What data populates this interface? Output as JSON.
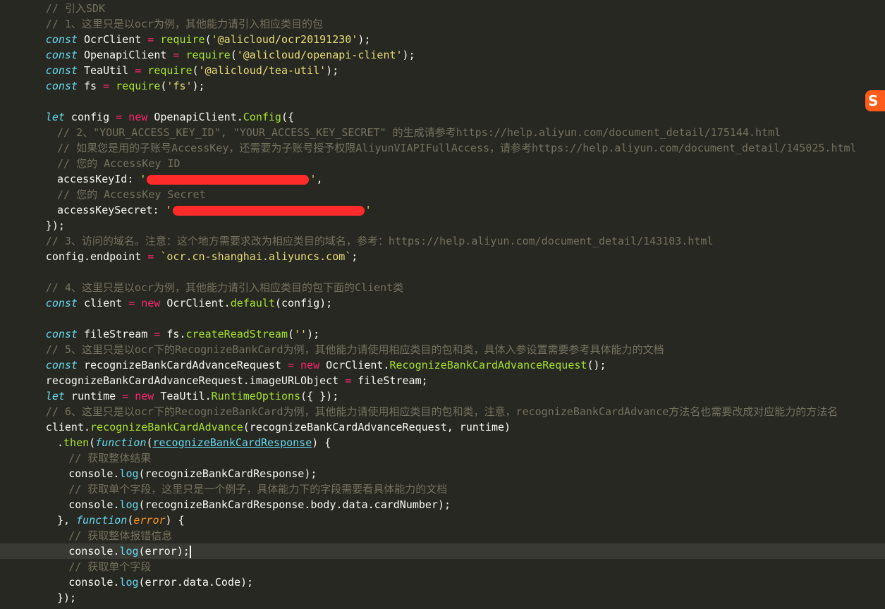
{
  "ime_logo_text": "S",
  "lines": [
    {
      "indent": 4,
      "tokens": [
        [
          "cm",
          "// 引入SDK"
        ]
      ]
    },
    {
      "indent": 4,
      "tokens": [
        [
          "cm",
          "// 1、这里只是以ocr为例，其他能力请引入相应类目的包"
        ]
      ]
    },
    {
      "indent": 4,
      "tokens": [
        [
          "kw",
          "const"
        ],
        [
          "var",
          " OcrClient "
        ],
        [
          "op",
          "="
        ],
        [
          "var",
          " "
        ],
        [
          "fn",
          "require"
        ],
        [
          "var",
          "("
        ],
        [
          "str",
          "'@alicloud/ocr20191230'"
        ],
        [
          "var",
          ");"
        ]
      ]
    },
    {
      "indent": 4,
      "tokens": [
        [
          "kw",
          "const"
        ],
        [
          "var",
          " OpenapiClient "
        ],
        [
          "op",
          "="
        ],
        [
          "var",
          " "
        ],
        [
          "fn",
          "require"
        ],
        [
          "var",
          "("
        ],
        [
          "str",
          "'@alicloud/openapi-client'"
        ],
        [
          "var",
          ");"
        ]
      ]
    },
    {
      "indent": 4,
      "tokens": [
        [
          "kw",
          "const"
        ],
        [
          "var",
          " TeaUtil "
        ],
        [
          "op",
          "="
        ],
        [
          "var",
          " "
        ],
        [
          "fn",
          "require"
        ],
        [
          "var",
          "("
        ],
        [
          "str",
          "'@alicloud/tea-util'"
        ],
        [
          "var",
          ");"
        ]
      ]
    },
    {
      "indent": 4,
      "tokens": [
        [
          "kw",
          "const"
        ],
        [
          "var",
          " fs "
        ],
        [
          "op",
          "="
        ],
        [
          "var",
          " "
        ],
        [
          "fn",
          "require"
        ],
        [
          "var",
          "("
        ],
        [
          "str",
          "'fs'"
        ],
        [
          "var",
          ");"
        ]
      ]
    },
    {
      "indent": 0,
      "tokens": []
    },
    {
      "indent": 4,
      "tokens": [
        [
          "kw",
          "let"
        ],
        [
          "var",
          " config "
        ],
        [
          "op",
          "="
        ],
        [
          "var",
          " "
        ],
        [
          "op",
          "new"
        ],
        [
          "var",
          " OpenapiClient."
        ],
        [
          "fn",
          "Config"
        ],
        [
          "var",
          "({"
        ]
      ]
    },
    {
      "indent": 5,
      "tokens": [
        [
          "cm",
          "// 2、\"YOUR_ACCESS_KEY_ID\", \"YOUR_ACCESS_KEY_SECRET\" 的生成请参考https://help.aliyun.com/document_detail/175144.html"
        ]
      ]
    },
    {
      "indent": 5,
      "tokens": [
        [
          "cm",
          "// 如果您是用的子账号AccessKey，还需要为子账号授予权限AliyunVIAPIFullAccess，请参考https://help.aliyun.com/document_detail/145025.html"
        ]
      ]
    },
    {
      "indent": 5,
      "tokens": [
        [
          "cm",
          "// 您的 AccessKey ID"
        ]
      ]
    },
    {
      "indent": 5,
      "tokens": [
        [
          "var",
          "accessKeyId: "
        ],
        [
          "str",
          "'"
        ],
        [
          "redact",
          "230"
        ],
        [
          "str",
          "'"
        ],
        [
          "var",
          ","
        ]
      ]
    },
    {
      "indent": 5,
      "tokens": [
        [
          "cm",
          "// 您的 AccessKey Secret"
        ]
      ]
    },
    {
      "indent": 5,
      "tokens": [
        [
          "var",
          "accessKeySecret: "
        ],
        [
          "str",
          "'"
        ],
        [
          "redact",
          "272"
        ],
        [
          "str",
          "'"
        ]
      ]
    },
    {
      "indent": 4,
      "tokens": [
        [
          "var",
          "});"
        ]
      ]
    },
    {
      "indent": 4,
      "tokens": [
        [
          "cm",
          "// 3、访问的域名。注意：这个地方需要求改为相应类目的域名，参考：https://help.aliyun.com/document_detail/143103.html"
        ]
      ]
    },
    {
      "indent": 4,
      "tokens": [
        [
          "var",
          "config.endpoint "
        ],
        [
          "op",
          "="
        ],
        [
          "var",
          " "
        ],
        [
          "str",
          "`ocr.cn-shanghai.aliyuncs.com`"
        ],
        [
          "var",
          ";"
        ]
      ]
    },
    {
      "indent": 0,
      "tokens": []
    },
    {
      "indent": 4,
      "tokens": [
        [
          "cm",
          "// 4、这里只是以ocr为例，其他能力请引入相应类目的包下面的Client类"
        ]
      ]
    },
    {
      "indent": 4,
      "tokens": [
        [
          "kw",
          "const"
        ],
        [
          "var",
          " client "
        ],
        [
          "op",
          "="
        ],
        [
          "var",
          " "
        ],
        [
          "op",
          "new"
        ],
        [
          "var",
          " OcrClient."
        ],
        [
          "fn",
          "default"
        ],
        [
          "var",
          "(config);"
        ]
      ]
    },
    {
      "indent": 0,
      "tokens": []
    },
    {
      "indent": 4,
      "tokens": [
        [
          "kw",
          "const"
        ],
        [
          "var",
          " fileStream "
        ],
        [
          "op",
          "="
        ],
        [
          "var",
          " fs."
        ],
        [
          "fn",
          "createReadStream"
        ],
        [
          "var",
          "("
        ],
        [
          "str",
          "''"
        ],
        [
          "var",
          ");"
        ]
      ]
    },
    {
      "indent": 4,
      "tokens": [
        [
          "cm",
          "// 5、这里只是以ocr下的RecognizeBankCard为例，其他能力请使用相应类目的包和类，具体入参设置需要参考具体能力的文档"
        ]
      ]
    },
    {
      "indent": 4,
      "tokens": [
        [
          "kw",
          "const"
        ],
        [
          "var",
          " recognizeBankCardAdvanceRequest "
        ],
        [
          "op",
          "="
        ],
        [
          "var",
          " "
        ],
        [
          "op",
          "new"
        ],
        [
          "var",
          " OcrClient."
        ],
        [
          "fn",
          "RecognizeBankCardAdvanceRequest"
        ],
        [
          "var",
          "();"
        ]
      ]
    },
    {
      "indent": 4,
      "tokens": [
        [
          "var",
          "recognizeBankCardAdvanceRequest.imageURLObject "
        ],
        [
          "op",
          "="
        ],
        [
          "var",
          " fileStream;"
        ]
      ]
    },
    {
      "indent": 4,
      "tokens": [
        [
          "kw",
          "let"
        ],
        [
          "var",
          " runtime "
        ],
        [
          "op",
          "="
        ],
        [
          "var",
          " "
        ],
        [
          "op",
          "new"
        ],
        [
          "var",
          " TeaUtil."
        ],
        [
          "fn",
          "RuntimeOptions"
        ],
        [
          "var",
          "({ });"
        ]
      ]
    },
    {
      "indent": 4,
      "tokens": [
        [
          "cm",
          "// 6、这里只是以ocr下的RecognizeBankCard为例，其他能力请使用相应类目的包和类，注意，recognizeBankCardAdvance方法名也需要改成对应能力的方法名"
        ]
      ]
    },
    {
      "indent": 4,
      "tokens": [
        [
          "var",
          "client."
        ],
        [
          "fn",
          "recognizeBankCardAdvance"
        ],
        [
          "var",
          "(recognizeBankCardAdvanceRequest, runtime)"
        ]
      ]
    },
    {
      "indent": 5,
      "tokens": [
        [
          "var",
          "."
        ],
        [
          "fn",
          "then"
        ],
        [
          "var",
          "("
        ],
        [
          "kw",
          "function"
        ],
        [
          "var",
          "("
        ],
        [
          "param-ul",
          "recognizeBankCardResponse"
        ],
        [
          "var",
          ") {"
        ]
      ]
    },
    {
      "indent": 6,
      "tokens": [
        [
          "cm",
          "// 获取整体结果"
        ]
      ]
    },
    {
      "indent": 6,
      "tokens": [
        [
          "var",
          "console."
        ],
        [
          "kwn",
          "log"
        ],
        [
          "var",
          "(recognizeBankCardResponse);"
        ]
      ]
    },
    {
      "indent": 6,
      "tokens": [
        [
          "cm",
          "// 获取单个字段，这里只是一个例子，具体能力下的字段需要看具体能力的文档"
        ]
      ]
    },
    {
      "indent": 6,
      "tokens": [
        [
          "var",
          "console."
        ],
        [
          "kwn",
          "log"
        ],
        [
          "var",
          "(recognizeBankCardResponse.body.data.cardNumber);"
        ]
      ]
    },
    {
      "indent": 5,
      "tokens": [
        [
          "var",
          "}, "
        ],
        [
          "kw",
          "function"
        ],
        [
          "var",
          "("
        ],
        [
          "param",
          "error"
        ],
        [
          "var",
          ") {"
        ]
      ]
    },
    {
      "indent": 6,
      "tokens": [
        [
          "cm",
          "// 获取整体报错信息"
        ]
      ]
    },
    {
      "indent": 6,
      "active": true,
      "tokens": [
        [
          "var",
          "console."
        ],
        [
          "kwn",
          "log"
        ],
        [
          "var",
          "(error);"
        ],
        [
          "cursor",
          ""
        ]
      ]
    },
    {
      "indent": 6,
      "tokens": [
        [
          "cm",
          "// 获取单个字段"
        ]
      ]
    },
    {
      "indent": 6,
      "tokens": [
        [
          "var",
          "console."
        ],
        [
          "kwn",
          "log"
        ],
        [
          "var",
          "(error.data.Code);"
        ]
      ]
    },
    {
      "indent": 5,
      "tokens": [
        [
          "var",
          "});"
        ]
      ]
    }
  ]
}
